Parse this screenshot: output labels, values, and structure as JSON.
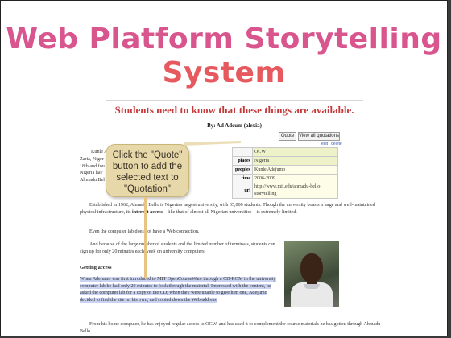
{
  "slide": {
    "title_line1": "Web Platform Storytelling",
    "title_line2": "System"
  },
  "callout": {
    "text": "Click the \"Quote\" button to add the selected text to \"Quotation\""
  },
  "page": {
    "headline": "Students need to know that these things are available.",
    "byline": "By: Ad Adeum (alexia)",
    "quote_button": "Quote",
    "view_quotations_button": "View all quotations",
    "links": [
      "edit",
      "delete"
    ]
  },
  "metadata": [
    {
      "key": "",
      "value": "OCW"
    },
    {
      "key": "places",
      "value": "Nigeria"
    },
    {
      "key": "peoples",
      "value": "Kunle Adejumo"
    },
    {
      "key": "time",
      "value": "2006-2009"
    },
    {
      "key": "url",
      "value": "http://www.mit.edu/ahmadu-bello-storytelling"
    }
  ],
  "body": {
    "intro_left": "Kunle A",
    "intro_rest": "Zaria, Niger 18th and fou Nigeria hav Ahmadu Bel",
    "p1": "Established in 1962, Ahmadu Bello is Nigeria's largest university, with 35,000 students. Though the university boasts a large and well-maintained physical infrastructure, its",
    "p1_bold": "internet access",
    "p1_end": "– like that of almost all Nigerian universities – is extremely limited.",
    "p2": "Even the computer lab does not have a Web connection.",
    "p3": "And because of the large number of students and the limited number of terminals, students can sign up for only 20 minutes each week on university computers.",
    "subhead": "Getting access",
    "p4": "When Adejumo was first introduced to MIT OpenCourseWare through a CD-ROM in the university computer lab he had only 20 minutes to look through the material. Impressed with the content, he asked the computer lab for a copy of the CD; when they were unable to give him one, Adejumo decided to find the site on his own, and copied down the Web address.",
    "p5": "From his home computer, he has enjoyed regular access to OCW, and has used it to complement the course materials he has gotten through Ahmadu Bello."
  },
  "colors": {
    "title_pink": "#d9558e",
    "headline_red": "#c43a3a",
    "callout_bg": "#e7d8a9",
    "highlight": "#c9d2f0"
  },
  "icons": [
    "portrait-photo"
  ]
}
